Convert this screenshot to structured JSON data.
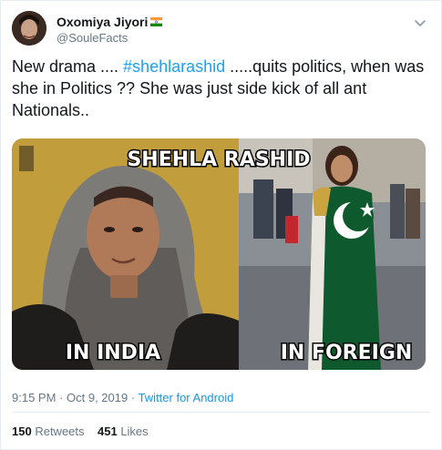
{
  "tweet": {
    "author_name": "Oxomiya Jiyori",
    "handle": "@SouleFacts",
    "text_before": "New drama .... ",
    "hashtag": "#shehlarashid",
    "text_after": "  .....quits politics, when was she in Politics ?? She was just side kick of all ant Nationals..",
    "time": "9:15 PM",
    "date": "Oct 9, 2019",
    "source": "Twitter for Android",
    "retweets_count": "150",
    "retweets_label": "Retweets",
    "likes_count": "451",
    "likes_label": "Likes"
  },
  "media": {
    "title": "SHEHLA RASHID",
    "left_caption": "IN INDIA",
    "right_caption": "IN FOREIGN"
  },
  "icons": {
    "flag": "india-flag-icon",
    "menu": "chevron-down-icon"
  },
  "colors": {
    "link": "#1da1f2",
    "source_link": "#1b95e0",
    "secondary_text": "#657786",
    "primary_text": "#14171a",
    "pakistan_green": "#0e5a2e"
  }
}
